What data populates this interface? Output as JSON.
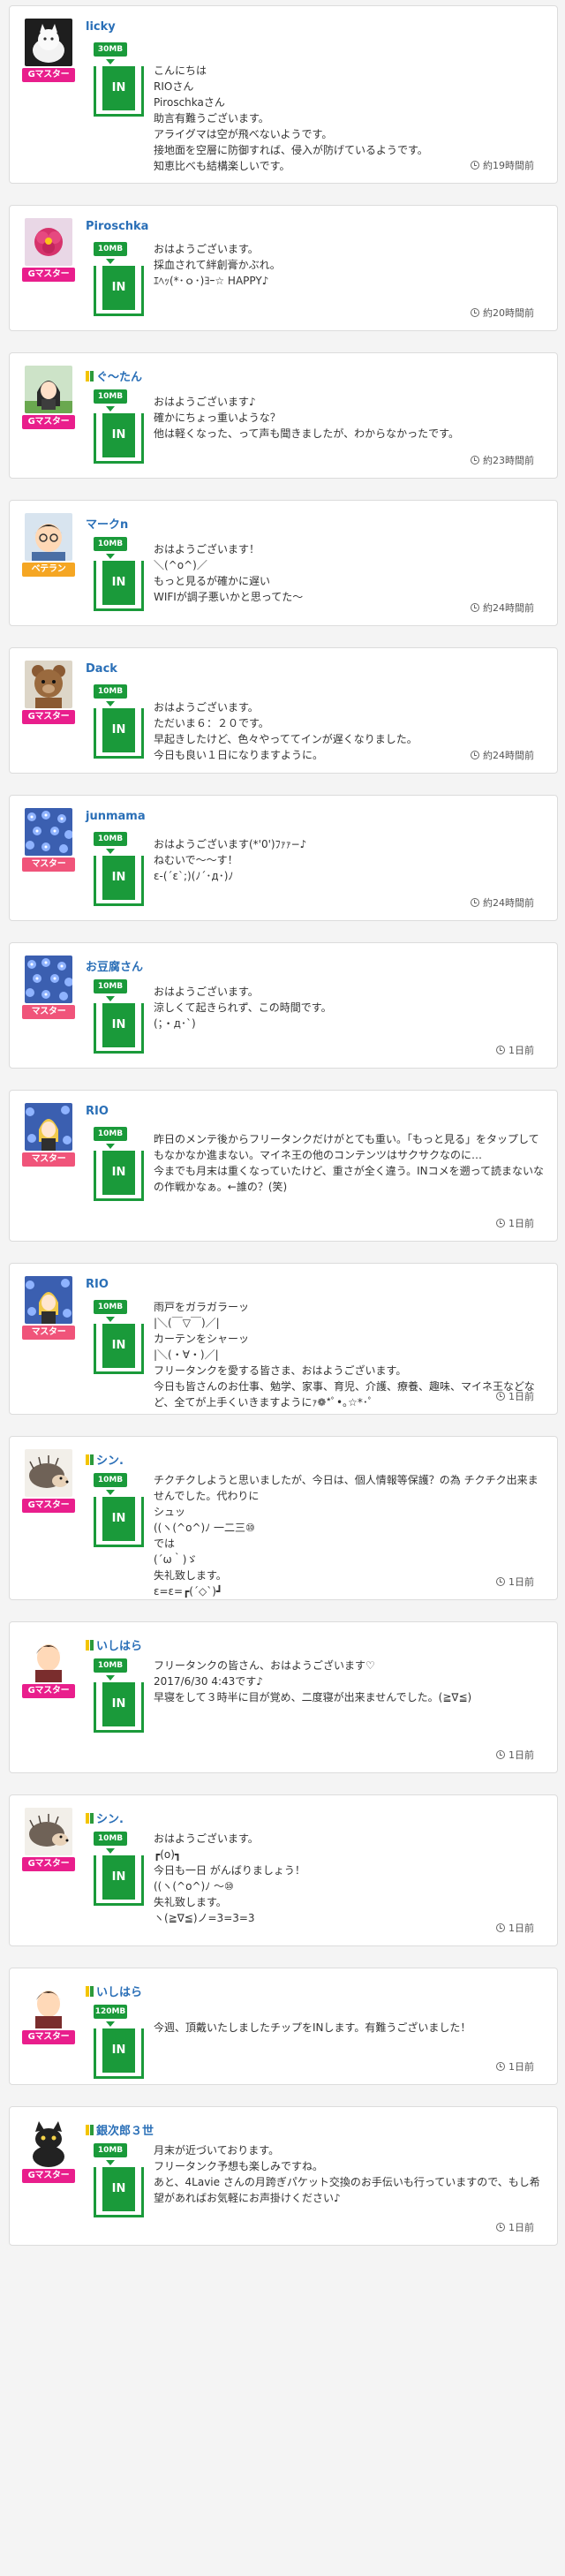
{
  "colors": {
    "gmaster": "#e91e8c",
    "master": "#f0547a",
    "veteran": "#f5a623",
    "in_green": "#1a9a3a",
    "username": "#2a6fb7"
  },
  "posts": [
    {
      "user": "licky",
      "beginner": false,
      "rank": "Gマスター",
      "rank_type": "gmaster",
      "avatar": "cat-avatar",
      "mb": "30MB",
      "in_label": "IN",
      "message": "こんにちは\nRIOさん\nPiroschkaさん\n助言有難うございます。\nアライグマは空が飛べないようです。\n接地面を空層に防御すれば、侵入が防げているようです。\n知恵比べも結構楽しいです。",
      "time": "約19時間前"
    },
    {
      "user": "Piroschka",
      "beginner": false,
      "rank": "Gマスター",
      "rank_type": "gmaster",
      "avatar": "flower-avatar",
      "mb": "10MB",
      "in_label": "IN",
      "message": "おはようございます。\n採血されて絆創膏かぶれ。\nｴﾍｯ(*･ｏ･)ﾖｰ☆ HAPPY♪",
      "time": "約20時間前"
    },
    {
      "user": "ぐ～たん",
      "beginner": true,
      "rank": "Gマスター",
      "rank_type": "gmaster",
      "avatar": "anime-avatar",
      "mb": "10MB",
      "in_label": "IN",
      "message": "おはようございます♪\n確かにちょっ重いような？\n他は軽くなった、って声も聞きましたが、わからなかったです。",
      "time": "約23時間前"
    },
    {
      "user": "マークn",
      "beginner": false,
      "rank": "ベテラン",
      "rank_type": "veteran",
      "avatar": "boy-avatar",
      "mb": "10MB",
      "in_label": "IN",
      "message": "おはようございます！\n＼(^o^)／\nもっと見るが確かに遅い\nWIFIが調子悪いかと思ってた〜",
      "time": "約24時間前"
    },
    {
      "user": "Dack",
      "beginner": false,
      "rank": "Gマスター",
      "rank_type": "gmaster",
      "avatar": "bear-avatar",
      "mb": "10MB",
      "in_label": "IN",
      "message": "おはようございます。\nただいま６：２０です。\n早起きしたけど、色々やっててインが遅くなりました。\n今日も良い１日になりますように。",
      "time": "約24時間前"
    },
    {
      "user": "junmama",
      "beginner": false,
      "rank": "マスター",
      "rank_type": "master",
      "avatar": "blue-flowers-avatar",
      "mb": "10MB",
      "in_label": "IN",
      "message": "おはようございます(*'0')ﾌｧｧ−♪\nねむいで〜〜す！\nε-(´ε`;)(ﾉ´･д･)ﾉ",
      "time": "約24時間前"
    },
    {
      "user": "お豆腐さん",
      "beginner": false,
      "rank": "マスター",
      "rank_type": "master",
      "avatar": "blue-flowers-avatar",
      "mb": "10MB",
      "in_label": "IN",
      "message": "おはようございます。\n涼しくて起きられず、この時間です。\n(；・д･`)",
      "time": "1日前"
    },
    {
      "user": "RIO",
      "beginner": false,
      "rank": "マスター",
      "rank_type": "master",
      "avatar": "girl-flowers-avatar",
      "mb": "10MB",
      "in_label": "IN",
      "message": "昨日のメンテ後からフリータンクだけがとても重い。「もっと見る」をタップしてもなかなか進まない。マイネ王の他のコンテンツはサクサクなのに…\n今までも月末は重くなっていたけど、重さが全く違う。INコメを遡って読まないなの作戦かなぁ。←誰の？(笑)",
      "time": "1日前"
    },
    {
      "user": "RIO",
      "beginner": false,
      "rank": "マスター",
      "rank_type": "master",
      "avatar": "girl-flowers-avatar",
      "mb": "10MB",
      "in_label": "IN",
      "message": "雨戸をガラガラーッ\n|＼(￣▽￣)／|\nカーテンをシャーッ\n|＼(・∀・)／|\nフリータンクを愛する皆さま、おはようございます。\n今日も皆さんのお仕事、勉学、家事、育児、介護、療養、趣味、マイネ王などなど、全てが上手くいきますようにｧ❁*ﾟ•｡☆*･ﾟ",
      "time": "1日前"
    },
    {
      "user": "シン.",
      "beginner": true,
      "rank": "Gマスター",
      "rank_type": "gmaster",
      "avatar": "hedgehog-avatar",
      "mb": "10MB",
      "in_label": "IN",
      "message": "チクチクしようと思いましたが、今日は、個人情報等保護？の為 チクチク出来ませんでした。代わりに\nシュッ\n((ヽ(^o^)ﾉ 一二三⑩\nでは\n(´ω｀)ゞ\n失礼致します。\nε=ε=┏(´◇`)┛",
      "time": "1日前"
    },
    {
      "user": "いしはら",
      "beginner": true,
      "rank": "Gマスター",
      "rank_type": "gmaster",
      "avatar": "man-avatar",
      "mb": "10MB",
      "in_label": "IN",
      "message": "フリータンクの皆さん、おはようございます♡\n2017/6/30 4:43です♪\n早寝をして３時半に目が覚め、二度寝が出来ませんでした。(≧∇≦)",
      "time": "1日前"
    },
    {
      "user": "シン.",
      "beginner": true,
      "rank": "Gマスター",
      "rank_type": "gmaster",
      "avatar": "hedgehog-avatar",
      "mb": "10MB",
      "in_label": "IN",
      "message": "おはようございます。\n┏(o)┓\n今日も一日 がんばりましょう！\n((ヽ(^o^)ﾉ 〜⑩\n失礼致します。\nヽ(≧∇≦)ノ=3=3=3",
      "time": "1日前"
    },
    {
      "user": "いしはら",
      "beginner": true,
      "rank": "Gマスター",
      "rank_type": "gmaster",
      "avatar": "man-avatar",
      "mb": "120MB",
      "in_label": "IN",
      "message": "今週、頂戴いたしましたチップをINします。有難うございました！",
      "time": "1日前"
    },
    {
      "user": "銀次郎３世",
      "beginner": true,
      "rank": "Gマスター",
      "rank_type": "gmaster",
      "avatar": "black-cat-avatar",
      "mb": "10MB",
      "in_label": "IN",
      "message": "月末が近づいております。\nフリータンク予想も楽しみですね。\nあと、4Lavie さんの月跨ぎパケット交換のお手伝いも行っていますので、もし希望があればお気軽にお声掛けください♪",
      "time": "1日前"
    }
  ]
}
